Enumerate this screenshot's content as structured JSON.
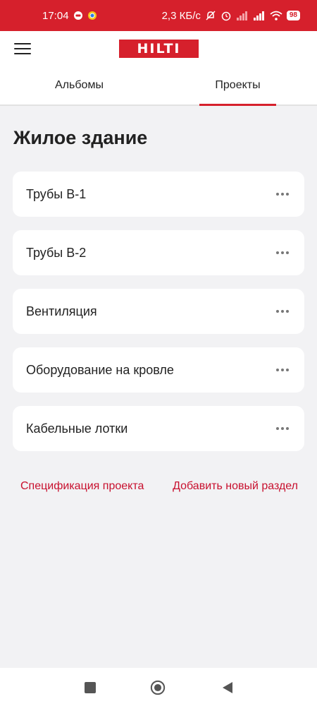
{
  "status_bar": {
    "time": "17:04",
    "network_speed": "2,3 КБ/с",
    "battery": "98",
    "icons": [
      "notification-icon",
      "chrome-icon",
      "mute-icon",
      "alarm-icon",
      "signal-icon",
      "signal-icon",
      "wifi-icon",
      "battery-icon"
    ]
  },
  "header": {
    "menu_icon": "hamburger-menu-icon",
    "logo_text": "HILTI",
    "brand_color": "#d6202c"
  },
  "tabs": [
    {
      "label": "Альбомы",
      "active": false
    },
    {
      "label": "Проекты",
      "active": true
    }
  ],
  "page": {
    "title": "Жилое здание"
  },
  "sections": [
    {
      "label": "Трубы В-1"
    },
    {
      "label": "Трубы В-2"
    },
    {
      "label": "Вентиляция"
    },
    {
      "label": "Оборудование на кровле"
    },
    {
      "label": "Кабельные лотки"
    }
  ],
  "actions": {
    "spec_label": "Спецификация проекта",
    "add_section_label": "Добавить новый раздел",
    "link_color": "#c8102e"
  },
  "nav_bar": {
    "icons": [
      "recent-apps-icon",
      "home-icon",
      "back-icon"
    ]
  }
}
